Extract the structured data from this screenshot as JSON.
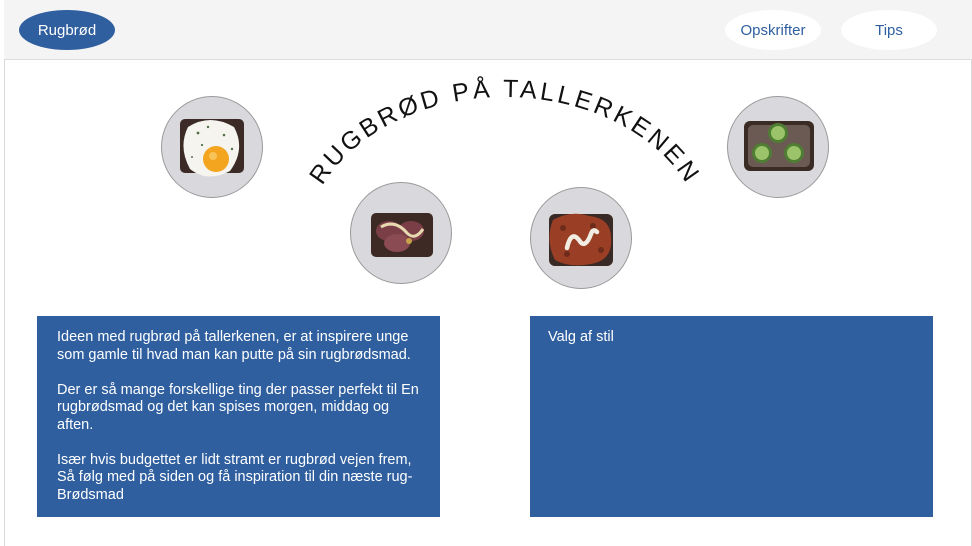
{
  "header": {
    "brand_label": "Rugbrød",
    "nav": [
      {
        "label": "Opskrifter"
      },
      {
        "label": "Tips"
      }
    ]
  },
  "hero": {
    "title": "RUGBRØD PÅ TALLERKENEN",
    "plates": [
      {
        "icon": "rye-bread-egg-plate"
      },
      {
        "icon": "rye-bread-sausage-plate"
      },
      {
        "icon": "rye-bread-meat-sauce-plate"
      },
      {
        "icon": "rye-bread-pate-cucumber-plate"
      }
    ]
  },
  "left_box": {
    "paragraphs": [
      "Ideen med rugbrød på tallerkenen, er at inspirere unge som gamle til hvad man kan putte på sin rugbrødsmad.",
      "Der er så mange forskellige ting der passer perfekt til En rugbrødsmad og det kan spises morgen, middag og aften.",
      "Især hvis budgettet er lidt stramt er rugbrød vejen frem, Så følg med på siden og få inspiration til din næste rug-Brødsmad"
    ]
  },
  "right_box": {
    "text": "Valg af stil"
  },
  "colors": {
    "accent": "#2f5f9f",
    "header_bg": "#f4f4f4",
    "plate": "#d9d9dd"
  }
}
